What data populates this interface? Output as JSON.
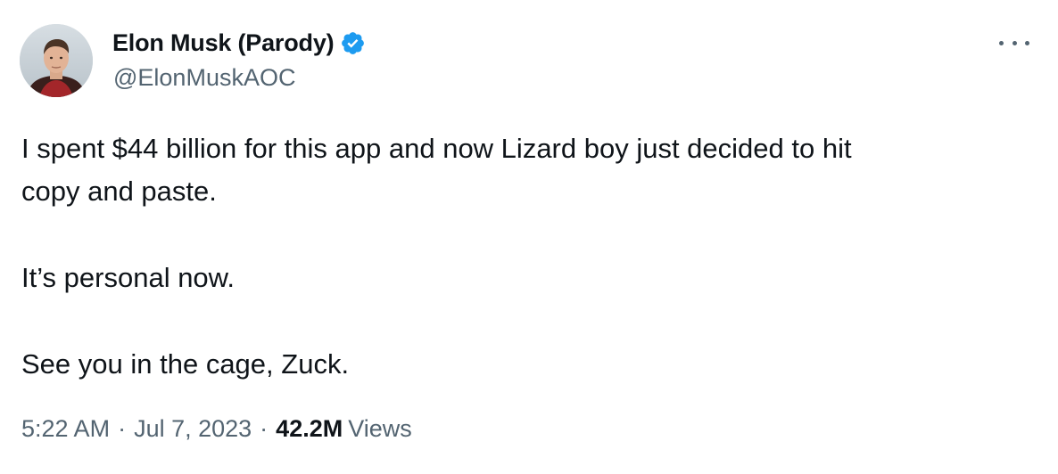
{
  "author": {
    "display_name": "Elon Musk (Parody)",
    "handle": "@ElonMuskAOC",
    "verified": true,
    "verified_color": "#1d9bf0",
    "avatar_icon": "profile-photo"
  },
  "tweet": {
    "lines": [
      "I spent $44 billion for this app and now Lizard boy just decided to hit",
      "copy and paste.",
      "It’s personal now.",
      "See you in the cage, Zuck."
    ]
  },
  "meta": {
    "time": "5:22 AM",
    "separator": "·",
    "date": "Jul 7, 2023",
    "views_count": "42.2M",
    "views_label": "Views"
  },
  "colors": {
    "text_primary": "#0f1419",
    "text_secondary": "#536471",
    "background": "#ffffff"
  }
}
